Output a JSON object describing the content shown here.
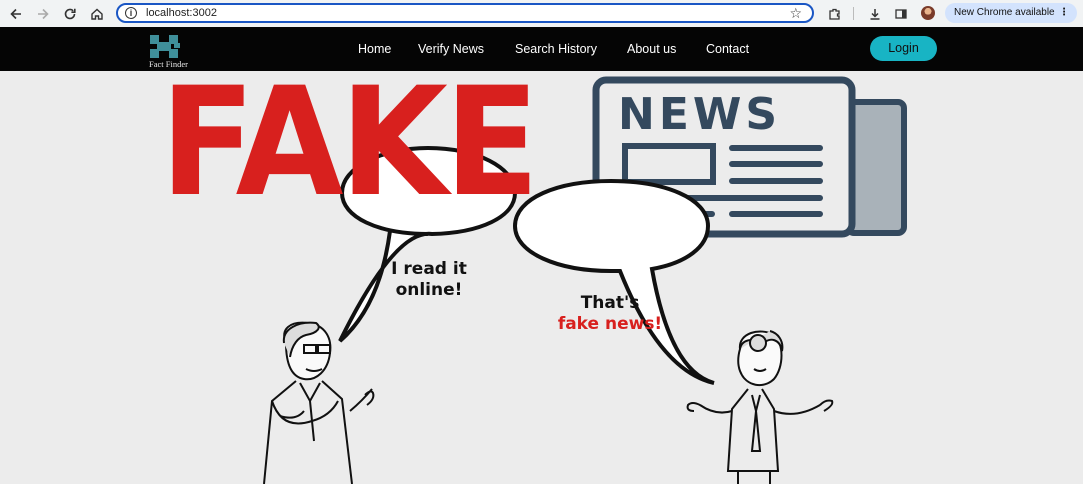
{
  "browser": {
    "url": "localhost:3002",
    "update_label": "New Chrome available",
    "more_glyph": "⋮",
    "icons": [
      "back-icon",
      "forward-icon",
      "reload-icon",
      "home-icon",
      "site-info-icon",
      "bookmark-star-icon",
      "extensions-icon",
      "download-icon",
      "side-panel-icon",
      "profile-avatar"
    ]
  },
  "site": {
    "logo_text": "Fact Finder",
    "nav": [
      "Home",
      "Verify News",
      "Search History",
      "About us",
      "Contact"
    ],
    "login_label": "Login"
  },
  "hero": {
    "headline": "FAKE",
    "newspaper_title": "NEWS",
    "bubble_left": [
      "I read it",
      "online!"
    ],
    "bubble_right": [
      "That's",
      "fake news!"
    ],
    "colors": {
      "fake_red": "#d8201e",
      "newspaper": "#34495e",
      "accent": "#18b4c4"
    }
  }
}
